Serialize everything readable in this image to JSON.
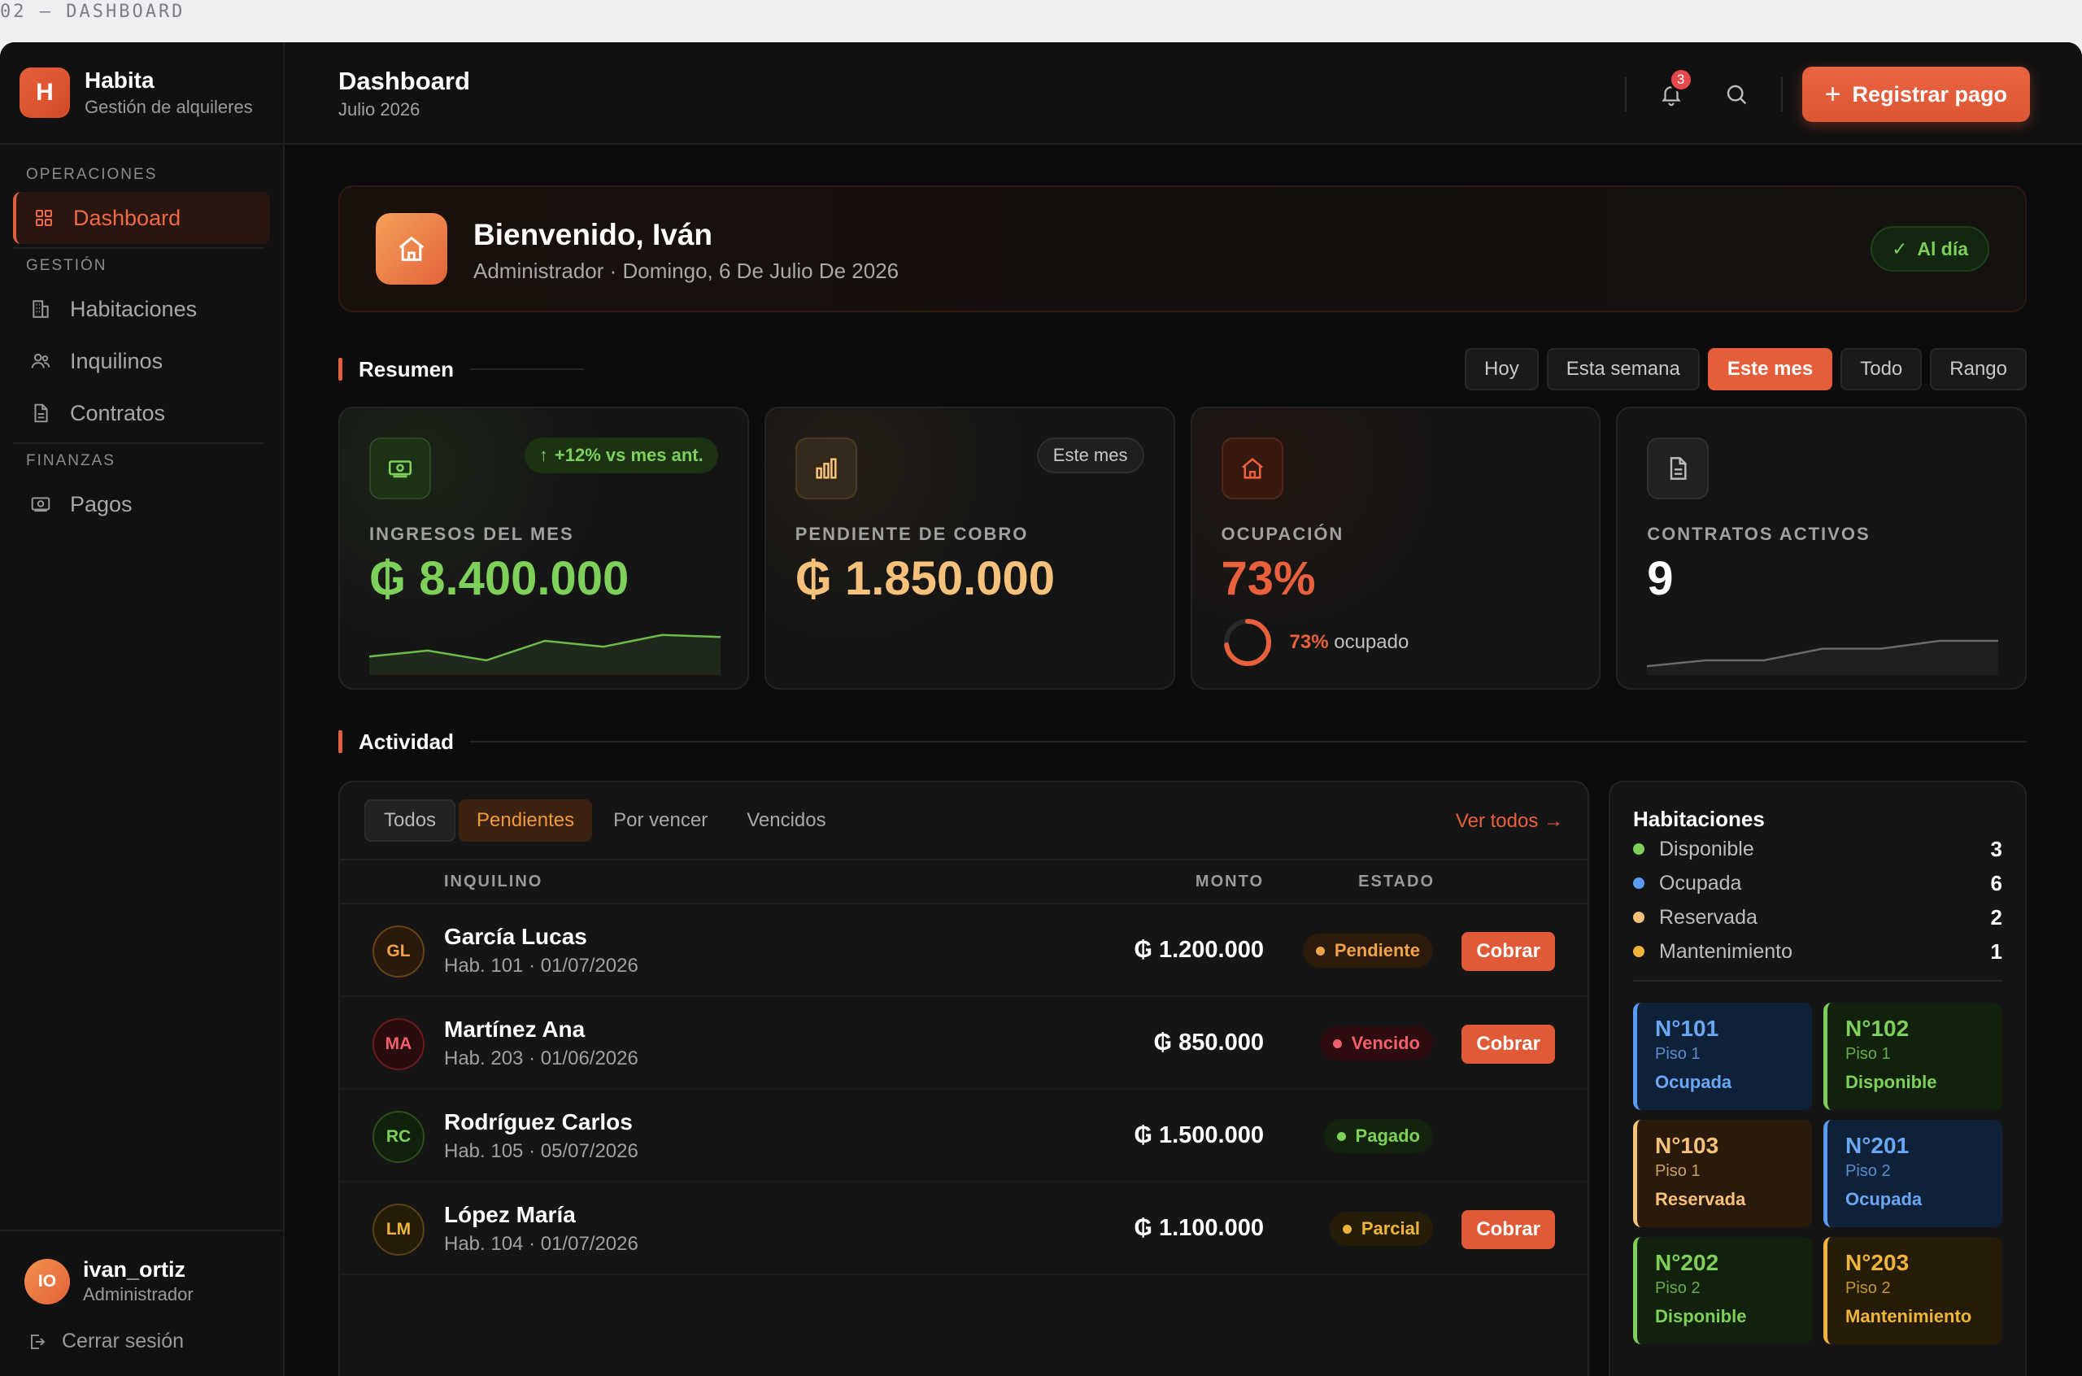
{
  "doc_label": "02 — DASHBOARD",
  "brand": {
    "initial": "H",
    "name": "Habita",
    "subtitle": "Gestión de alquileres"
  },
  "nav": {
    "sections": [
      "Operaciones",
      "Gestión",
      "Finanzas"
    ],
    "items": [
      {
        "label": "Dashboard",
        "icon": "grid-icon",
        "active": true
      },
      {
        "label": "Habitaciones",
        "icon": "building-icon"
      },
      {
        "label": "Inquilinos",
        "icon": "users-icon"
      },
      {
        "label": "Contratos",
        "icon": "file-icon"
      },
      {
        "label": "Pagos",
        "icon": "cash-icon"
      }
    ]
  },
  "user": {
    "initials": "IO",
    "name": "ivan_ortiz",
    "role": "Administrador",
    "logout": "Cerrar sesión"
  },
  "header": {
    "title": "Dashboard",
    "subtitle": "Julio 2026",
    "notifications": "3",
    "primary_action": "Registrar pago"
  },
  "welcome": {
    "title": "Bienvenido, Iván",
    "subtitle": "Administrador · Domingo, 6 De Julio De 2026",
    "status": "Al día"
  },
  "resumen": {
    "title": "Resumen",
    "filters": [
      "Hoy",
      "Esta semana",
      "Este mes",
      "Todo",
      "Rango"
    ],
    "active_filter": "Este mes"
  },
  "kpis": [
    {
      "label": "Ingresos del mes",
      "value": "₲ 8.400.000",
      "tag": "+12% vs mes ant.",
      "color": "#7ed05a",
      "spark": [
        0.35,
        0.5,
        0.25,
        0.75,
        0.6,
        0.9,
        0.85
      ]
    },
    {
      "label": "Pendiente de cobro",
      "value": "₲ 1.850.000",
      "tag": "Este mes",
      "color": "#f6c17a"
    },
    {
      "label": "Ocupación",
      "value": "73%",
      "occupancy": 0.73,
      "occ_pct": "73%",
      "occ_text": "ocupado",
      "color": "#e8603c"
    },
    {
      "label": "Contratos activos",
      "value": "9",
      "color": "#ffffff",
      "spark": [
        0.1,
        0.25,
        0.25,
        0.55,
        0.55,
        0.75,
        0.75
      ]
    }
  ],
  "actividad": {
    "title": "Actividad",
    "tabs": [
      "Todos",
      "Pendientes",
      "Por vencer",
      "Vencidos"
    ],
    "see_all": "Ver todos →",
    "columns": {
      "tenant": "INQUILINO",
      "amount": "MONTO",
      "status": "ESTADO"
    },
    "rows": [
      {
        "initials": "GL",
        "name": "García Lucas",
        "meta": "Hab. 101 · 01/07/2026",
        "amount": "₲ 1.200.000",
        "status": "Pendiente",
        "tone": "pend",
        "action": "Cobrar"
      },
      {
        "initials": "MA",
        "name": "Martínez Ana",
        "meta": "Hab. 203 · 01/06/2026",
        "amount": "₲ 850.000",
        "status": "Vencido",
        "tone": "venc",
        "action": "Cobrar"
      },
      {
        "initials": "RC",
        "name": "Rodríguez Carlos",
        "meta": "Hab. 105 · 05/07/2026",
        "amount": "₲ 1.500.000",
        "status": "Pagado",
        "tone": "pag",
        "action": ""
      },
      {
        "initials": "LM",
        "name": "López María",
        "meta": "Hab. 104 · 01/07/2026",
        "amount": "₲ 1.100.000",
        "status": "Parcial",
        "tone": "parc",
        "action": "Cobrar"
      }
    ]
  },
  "habitaciones": {
    "title": "Habitaciones",
    "legend": [
      {
        "label": "Disponible",
        "count": "3",
        "color": "#7ed05a"
      },
      {
        "label": "Ocupada",
        "count": "6",
        "color": "#5b9cf2"
      },
      {
        "label": "Reservada",
        "count": "2",
        "color": "#f6c17a"
      },
      {
        "label": "Mantenimiento",
        "count": "1",
        "color": "#f0b43a"
      }
    ],
    "rooms": [
      {
        "number": "N°101",
        "floor": "Piso 1",
        "status": "Ocupada",
        "kind": "ocu"
      },
      {
        "number": "N°102",
        "floor": "Piso 1",
        "status": "Disponible",
        "kind": "dis"
      },
      {
        "number": "N°103",
        "floor": "Piso 1",
        "status": "Reservada",
        "kind": "res"
      },
      {
        "number": "N°201",
        "floor": "Piso 2",
        "status": "Ocupada",
        "kind": "ocu"
      },
      {
        "number": "N°202",
        "floor": "Piso 2",
        "status": "Disponible",
        "kind": "dis"
      },
      {
        "number": "N°203",
        "floor": "Piso 2",
        "status": "Mantenimiento",
        "kind": "man"
      }
    ]
  }
}
